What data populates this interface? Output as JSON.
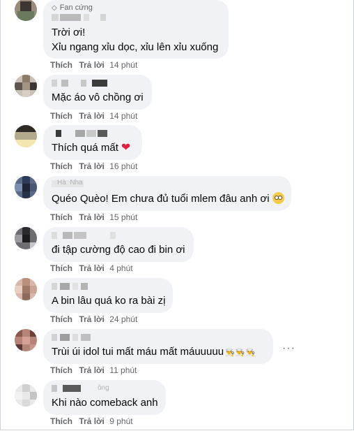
{
  "labels": {
    "like": "Thích",
    "reply": "Trả lời"
  },
  "comments": [
    {
      "badge": "Fan cứng",
      "lines": [
        "Trời ơi!",
        "Xỉu ngang xỉu dọc, xỉu lên xỉu xuống"
      ],
      "time": "14 phút"
    },
    {
      "lines": [
        "Mặc áo vô chồng ơi"
      ],
      "time": "14 phút"
    },
    {
      "lines": [
        "Thích quá mất"
      ],
      "reaction_icon": "heart-emoji",
      "time": "16 phút"
    },
    {
      "name_fragment": "Hà  Nha",
      "lines": [
        "Quéo Quèo! Em chưa đủ tuổi mlem đâu anh ơi"
      ],
      "reaction_icon": "rolling-eyes-emoji",
      "time": "15 phút"
    },
    {
      "lines": [
        "đi tập cường độ cao đi bin ơi"
      ],
      "time": "4 phút"
    },
    {
      "lines": [
        "A bin lâu quá ko ra bài zị"
      ],
      "time": "24 phút"
    },
    {
      "lines": [
        "Trùi úi idol tui mất máu mất máuuuuu"
      ],
      "reaction_icon": "cook-emoji-x3",
      "time": "11 phút"
    },
    {
      "name_fragment": "ông",
      "lines": [
        "Khi nào comeback anh"
      ],
      "time": "9 phút"
    }
  ]
}
